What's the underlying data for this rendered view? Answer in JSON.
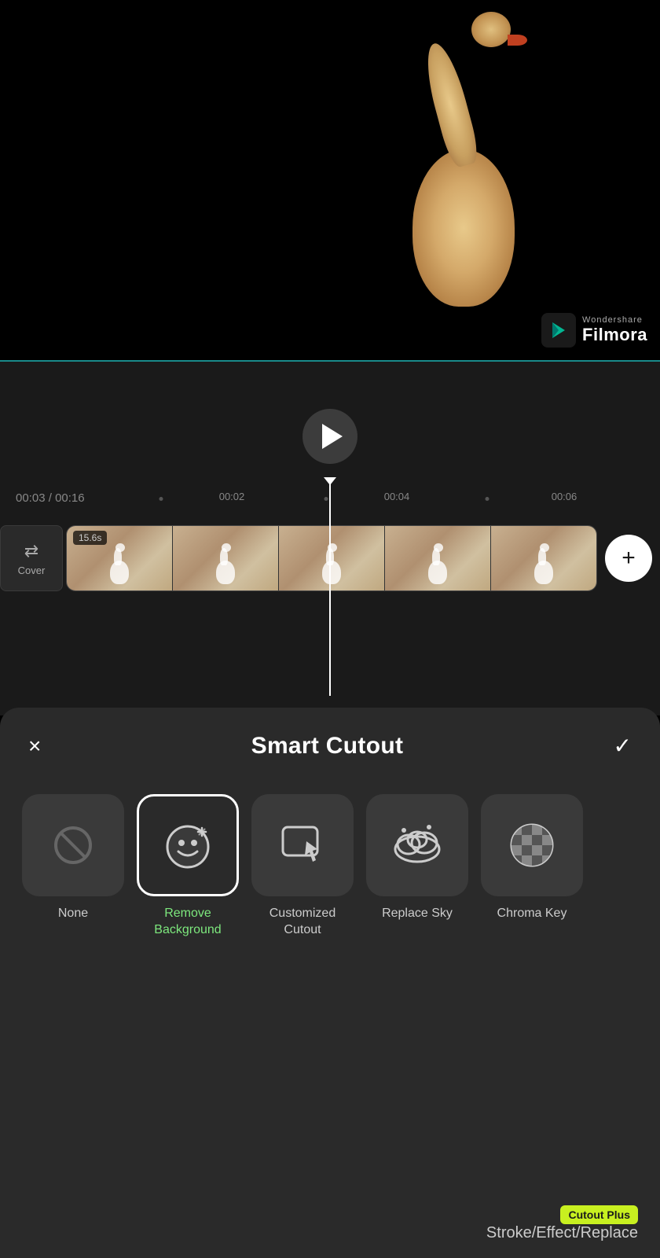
{
  "app": {
    "name": "Filmora",
    "brand": "Wondershare"
  },
  "video_preview": {
    "background_color": "#000000"
  },
  "watermark": {
    "brand": "Wondershare",
    "name": "Filmora"
  },
  "timeline": {
    "current_time": "00:03",
    "total_time": "00:16",
    "markers": [
      "00:02",
      "00:04",
      "00:06"
    ],
    "clip_duration": "15.6s",
    "cover_label": "Cover"
  },
  "smart_cutout": {
    "title": "Smart Cutout",
    "close_label": "×",
    "confirm_label": "✓",
    "options": [
      {
        "id": "none",
        "label": "None",
        "icon": "ban-icon",
        "selected": false,
        "active_label": false
      },
      {
        "id": "remove-background",
        "label": "Remove\nBackground",
        "icon": "remove-bg-icon",
        "selected": true,
        "active_label": true
      },
      {
        "id": "customized-cutout",
        "label": "Customized\nCutout",
        "icon": "cutout-icon",
        "selected": false,
        "active_label": false
      },
      {
        "id": "replace-sky",
        "label": "Replace Sky",
        "icon": "sky-icon",
        "selected": false,
        "active_label": false
      },
      {
        "id": "chroma-key",
        "label": "Chroma Key",
        "icon": "chroma-icon",
        "selected": false,
        "active_label": false
      }
    ],
    "bottom_bar": {
      "text": "Stroke/Effect/Replace",
      "badge": "Cutout Plus"
    }
  },
  "controls": {
    "play_button_label": "▶",
    "add_clip_label": "+"
  }
}
